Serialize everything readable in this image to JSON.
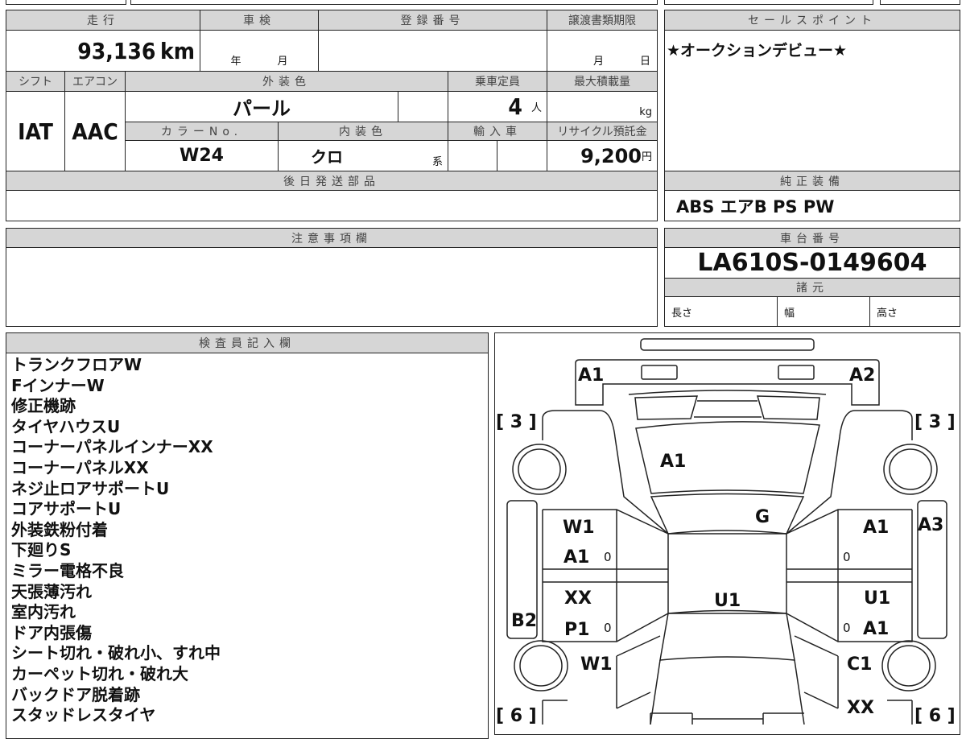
{
  "table": {
    "mileage_label": "走行",
    "mileage": "93,136",
    "mileage_unit": "km",
    "inspection_label": "車検",
    "year_unit": "年",
    "month_unit": "月",
    "registration_label": "登録番号",
    "transfer_deadline_label": "譲渡書類期限",
    "day_unit": "日",
    "shift_label": "シフト",
    "shift": "IAT",
    "aircon_label": "エアコン",
    "aircon": "AAC",
    "exterior_color_label": "外装色",
    "exterior_color": "パール",
    "capacity_label": "乗車定員",
    "capacity": "4",
    "capacity_unit": "人",
    "max_load_label": "最大積載量",
    "max_load_unit": "kg",
    "color_no_label": "カラーNo.",
    "color_no": "W24",
    "interior_color_label": "内装色",
    "interior_color": "クロ",
    "interior_suffix": "系",
    "import_label": "輸入車",
    "recycle_label": "リサイクル預託金",
    "recycle_fee": "9,200",
    "recycle_unit": "円",
    "later_parts_label": "後日発送部品"
  },
  "sales_point": {
    "label": "セールスポイント",
    "text": "★オークションデビュー★"
  },
  "equipment": {
    "label": "純正装備",
    "text": "ABS エアB PS PW"
  },
  "notes": {
    "label": "注意事項欄"
  },
  "chassis": {
    "label": "車台番号",
    "value": "LA610S-0149604",
    "specs_label": "諸元",
    "length": "長さ",
    "width": "幅",
    "height": "高さ"
  },
  "inspector": {
    "label": "検査員記入欄",
    "lines": [
      "トランクフロアW",
      "FインナーW",
      "修正機跡",
      "タイヤハウスU",
      "コーナーパネルインナーXX",
      "コーナーパネルXX",
      "ネジ止ロアサポートU",
      "コアサポートU",
      "外装鉄粉付着",
      "下廻りS",
      "ミラー電格不良",
      "天張薄汚れ",
      "室内汚れ",
      "ドア内張傷",
      "シート切れ・破れ小、すれ中",
      "カーペット切れ・破れ大",
      "バックドア脱着跡",
      "スタッドレスタイヤ"
    ]
  },
  "diagram": {
    "tread_front_left": "[ 3 ]",
    "tread_front_right": "[ 3 ]",
    "tread_rear_left": "[ 6 ]",
    "tread_rear_right": "[ 6 ]",
    "marks": {
      "hatch_left": "A1",
      "hatch_right": "A2",
      "rear_glass": "A1",
      "roof": "G",
      "rear_door_left_1": "W1",
      "rear_door_left_2": "A1",
      "zero1": "0",
      "front_door_left_1": "XX",
      "front_door_left_2": "P1",
      "zero2": "0",
      "step_left": "B2",
      "cabin": "U1",
      "fender_left": "W1",
      "rear_door_right": "A1",
      "zero3": "0",
      "step_right": "A3",
      "front_door_right_1": "U1",
      "zero4": "0",
      "front_door_right_2": "A1",
      "fender_right": "C1",
      "front_right": "XX"
    }
  }
}
